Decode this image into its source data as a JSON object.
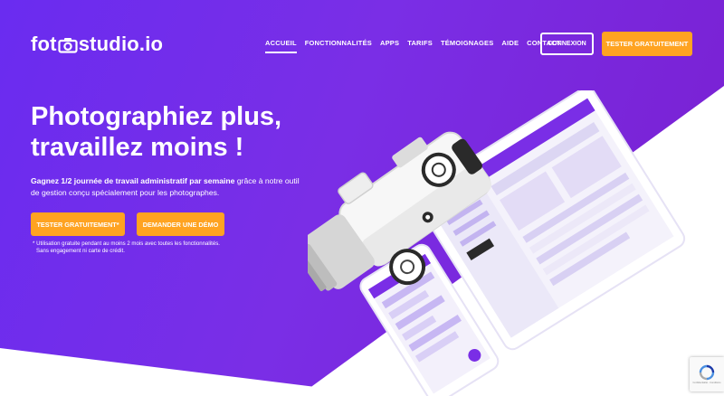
{
  "brand": {
    "logo_left": "fot",
    "logo_right": "studio.io"
  },
  "nav": {
    "items": [
      {
        "label": "ACCUEIL",
        "active": true
      },
      {
        "label": "FONCTIONNALITÉS",
        "active": false
      },
      {
        "label": "APPS",
        "active": false
      },
      {
        "label": "TARIFS",
        "active": false
      },
      {
        "label": "TÉMOIGNAGES",
        "active": false
      },
      {
        "label": "AIDE",
        "active": false
      },
      {
        "label": "CONTACT",
        "active": false
      }
    ],
    "login_label": "CONNEXION",
    "cta_label": "TESTER GRATUITEMENT"
  },
  "hero": {
    "headline_line1": "Photographiez plus,",
    "headline_line2": "travaillez moins !",
    "sub_bold": "Gagnez 1/2 journée de travail administratif par semaine",
    "sub_rest": " grâce à notre outil de gestion conçu spécialement pour les photographes.",
    "cta_primary": "TESTER GRATUITEMENT*",
    "cta_secondary": "DEMANDER UNE DÉMO",
    "note_line1": "* Utilisation gratuite pendant au moins 2 mois avec toutes les fonctionnalités.",
    "note_line2": "Sans engagement ni carte de crédit."
  },
  "recaptcha": {
    "text": "Confidentialité - Conditions"
  },
  "colors": {
    "accent": "#6a2cf0",
    "orange": "#ffa321",
    "white": "#ffffff"
  }
}
